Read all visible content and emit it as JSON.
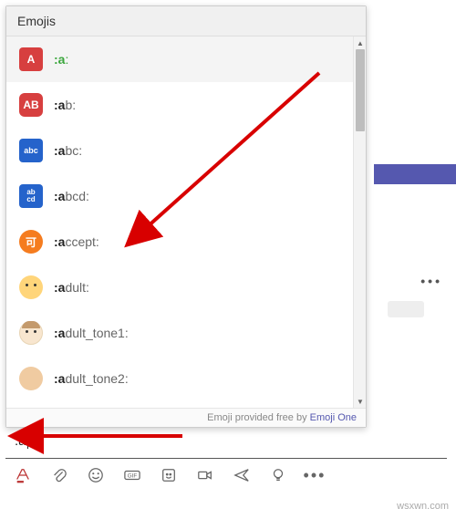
{
  "purple_bar": true,
  "popup": {
    "title": "Emojis",
    "items": [
      {
        "code": ":a:",
        "match": ":a",
        "rest": ":",
        "icon": "i-a",
        "label": "A"
      },
      {
        "code": ":ab:",
        "match": ":a",
        "rest": "b:",
        "icon": "i-ab",
        "label": "AB"
      },
      {
        "code": ":abc:",
        "match": ":a",
        "rest": "bc:",
        "icon": "i-abc",
        "label": "abc"
      },
      {
        "code": ":abcd:",
        "match": ":a",
        "rest": "bcd:",
        "icon": "i-abcd",
        "label": "ab\ncd"
      },
      {
        "code": ":accept:",
        "match": ":a",
        "rest": "ccept:",
        "icon": "i-accept",
        "label": "可"
      },
      {
        "code": ":adult:",
        "match": ":a",
        "rest": "dult:",
        "icon": "i-adult",
        "label": ""
      },
      {
        "code": ":adult_tone1:",
        "match": ":a",
        "rest": "dult_tone1:",
        "icon": "i-t1",
        "label": ""
      },
      {
        "code": ":adult_tone2:",
        "match": ":a",
        "rest": "dult_tone2:",
        "icon": "i-t2",
        "label": ""
      }
    ],
    "footer_text": "Emoji provided free by ",
    "footer_link": "Emoji One"
  },
  "compose": {
    "value": ":a"
  },
  "toolbar": {
    "icons": [
      "format",
      "attach",
      "emoji",
      "gif",
      "sticker",
      "meet",
      "send",
      "bulb",
      "more"
    ]
  },
  "watermark": "wsxwn.com"
}
